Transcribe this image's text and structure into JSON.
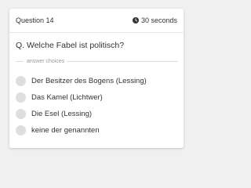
{
  "header": {
    "question_number": "Question 14",
    "timer_text": "30 seconds",
    "timer_icon": "clock-icon"
  },
  "question": {
    "text": "Q. Welche Fabel ist politisch?"
  },
  "divider": {
    "label": "answer choices"
  },
  "choices": [
    {
      "label": "Der Besitzer des Bogens (Lessing)"
    },
    {
      "label": "Das Kamel (Lichtwer)"
    },
    {
      "label": "Die Esel (Lessing)"
    },
    {
      "label": "keine der genannten"
    }
  ],
  "colors": {
    "background": "#f0f0f0",
    "card": "#ffffff",
    "radio": "#dedede",
    "text": "#333333",
    "muted": "#9a9a9a"
  }
}
